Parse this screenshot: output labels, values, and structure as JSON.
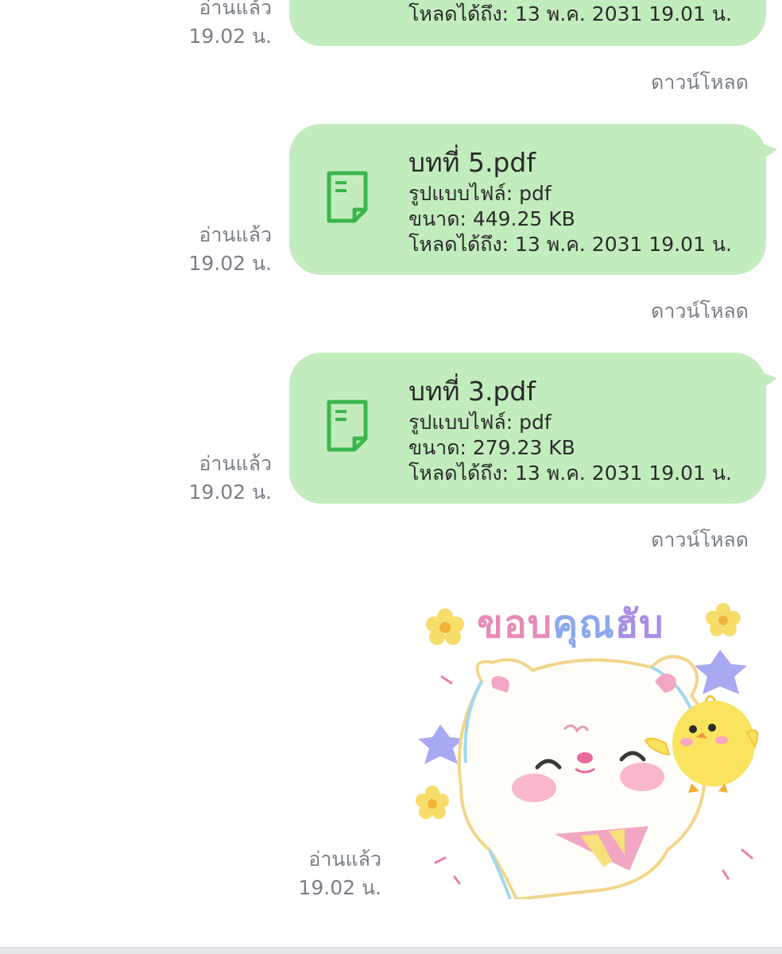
{
  "messages": [
    {
      "read_label": "อ่านแล้ว",
      "read_time": "19.02 น.",
      "expiry": "โหลดได้ถึง: 13 พ.ค. 2031 19.01 น.",
      "download": "ดาวน์โหลด"
    },
    {
      "read_label": "อ่านแล้ว",
      "read_time": "19.02 น.",
      "file_name": "บทที่ 5.pdf",
      "file_type": "รูปแบบไฟล์: pdf",
      "size": "ขนาด: 449.25 KB",
      "expiry": "โหลดได้ถึง: 13 พ.ค. 2031 19.01 น.",
      "download": "ดาวน์โหลด"
    },
    {
      "read_label": "อ่านแล้ว",
      "read_time": "19.02 น.",
      "file_name": "บทที่ 3.pdf",
      "file_type": "รูปแบบไฟล์: pdf",
      "size": "ขนาด: 279.23 KB",
      "expiry": "โหลดได้ถึง: 13 พ.ค. 2031 19.01 น.",
      "download": "ดาวน์โหลด"
    }
  ],
  "sticker": {
    "text_part1": "ขอบ",
    "text_part2": "คุณ",
    "text_part3": "ฮับ",
    "read_label": "อ่านแล้ว",
    "read_time": "19.02 น."
  },
  "colors": {
    "bubble": "#c3ecbe",
    "file_icon": "#3cb64a",
    "meta_text": "#7a7f87"
  },
  "icons": {
    "file": "document-file-icon"
  }
}
